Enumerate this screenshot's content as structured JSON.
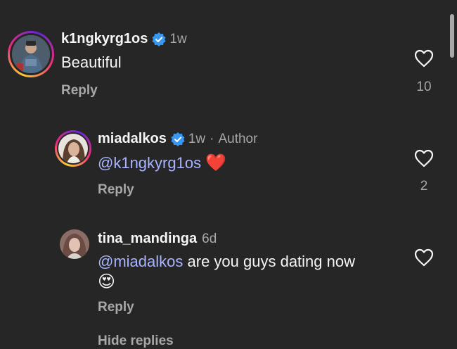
{
  "comments": [
    {
      "username": "k1ngkyrg1os",
      "time": "1w",
      "text": "Beautiful",
      "reply_label": "Reply",
      "likes": "10"
    },
    {
      "username": "miadalkos",
      "time": "1w",
      "author_label": "Author",
      "mention": "@k1ngkyrg1os",
      "emoji": "❤️",
      "reply_label": "Reply",
      "likes": "2"
    },
    {
      "username": "tina_mandinga",
      "time": "6d",
      "mention": "@miadalkos",
      "text": "are you guys dating now",
      "emoji": "😍",
      "reply_label": "Reply"
    }
  ],
  "hide_replies_label": "Hide replies",
  "colors": {
    "background": "#262626",
    "mention": "#a8b4ff",
    "verified": "#3897f0",
    "secondary": "#a8a8a8"
  }
}
